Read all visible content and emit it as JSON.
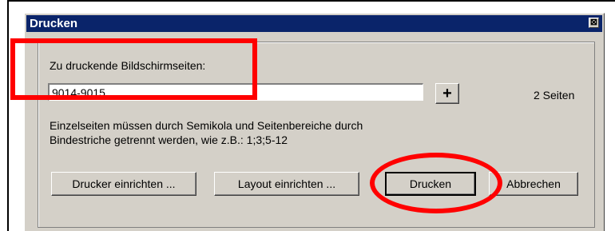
{
  "dialog": {
    "title": "Drucken",
    "close_symbol": "⊠"
  },
  "pages_field": {
    "label": "Zu druckende Bildschirmseiten:",
    "value": "9014-9015",
    "count_text": "2 Seiten"
  },
  "hint": {
    "line1": "Einzelseiten müssen durch Semikola und Seitenbereiche durch",
    "line2": "Bindestriche getrennt werden, wie z.B.: 1;3;5-12"
  },
  "buttons": {
    "add": "+",
    "printer_setup": "Drucker einrichten ...",
    "layout_setup": "Layout einrichten ...",
    "print": "Drucken",
    "cancel": "Abbrechen"
  },
  "colors": {
    "titlebar": "#0a246a",
    "dialog_face": "#d4d0c8",
    "annotation": "#ff0000"
  },
  "icons": {
    "close": "close-icon"
  }
}
